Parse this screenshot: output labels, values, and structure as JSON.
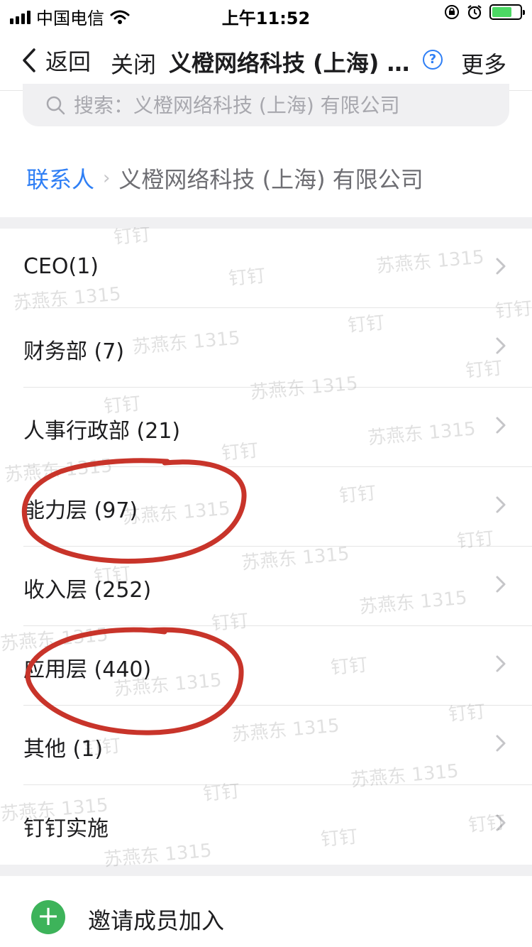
{
  "status_bar": {
    "carrier": "中国电信",
    "time": "上午11:52"
  },
  "nav": {
    "back_label": "返回",
    "close_label": "关闭",
    "title": "义橙网络科技 (上海) 有限公司",
    "help_symbol": "?",
    "more_label": "更多"
  },
  "search": {
    "placeholder": "搜索：义橙网络科技 (上海) 有限公司"
  },
  "breadcrumb": {
    "root": "联系人",
    "separator": "›",
    "current": "义橙网络科技 (上海) 有限公司"
  },
  "departments": [
    {
      "label": "CEO(1)"
    },
    {
      "label": "财务部 (7)"
    },
    {
      "label": "人事行政部 (21)"
    },
    {
      "label": "能力层 (97)"
    },
    {
      "label": "收入层 (252)"
    },
    {
      "label": "应用层 (440)"
    },
    {
      "label": "其他 (1)"
    },
    {
      "label": "钉钉实施"
    }
  ],
  "invite": {
    "icon": "plus-icon",
    "label": "邀请成员加入"
  },
  "watermark": {
    "name": "苏燕东 1315",
    "brand": "钉钉"
  },
  "colors": {
    "accent": "#2f7ff5",
    "invite_green": "#3db35a",
    "annotation_red": "#c8342a"
  }
}
